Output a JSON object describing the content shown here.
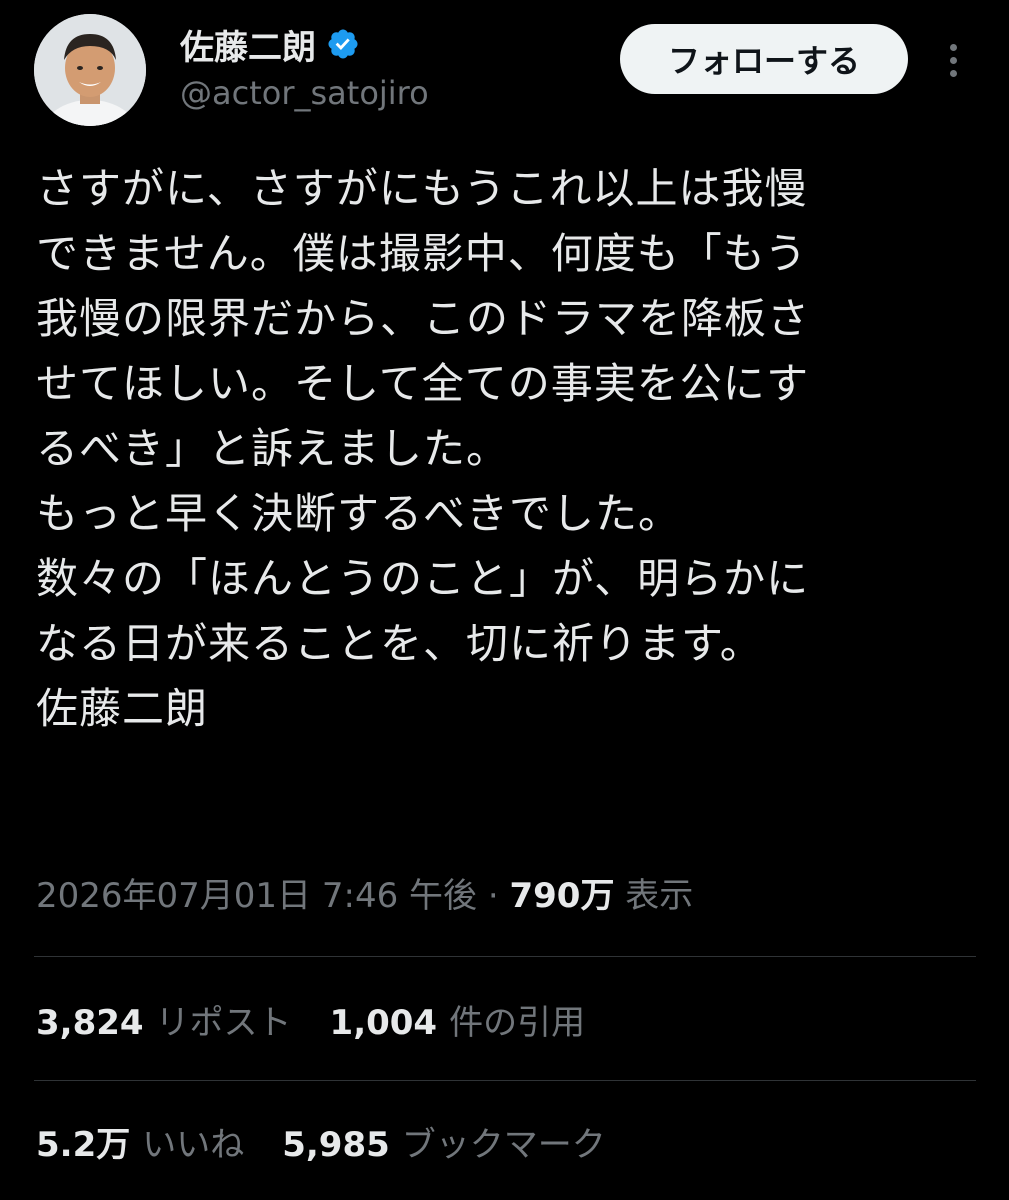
{
  "author": {
    "display_name": "佐藤二朗",
    "handle": "@actor_satojiro",
    "verified_color": "#1d9bf0"
  },
  "follow_button": {
    "label": "フォローする"
  },
  "more_icon": "more-vertical-icon",
  "tweet": {
    "lines": [
      "さすがに、さすがにもうこれ以上は我慢",
      "できません。僕は撮影中、何度も「もう",
      "我慢の限界だから、このドラマを降板さ",
      "せてほしい。そして全ての事実を公にす",
      "るべき」と訴えました。",
      "もっと早く決断するべきでした。",
      "数々の「ほんとうのこと」が、明らかに",
      "なる日が来ることを、切に祈ります。",
      "佐藤二朗"
    ]
  },
  "meta": {
    "timestamp": "2026年07月01日 7:46 午後",
    "separator": " · ",
    "views_count": "790万",
    "views_label": " 表示"
  },
  "stats": {
    "reposts": {
      "count": "3,824",
      "label": "リポスト"
    },
    "quotes": {
      "count": "1,004",
      "label": "件の引用"
    },
    "likes": {
      "count": "5.2万",
      "label": "いいね"
    },
    "bookmarks": {
      "count": "5,985",
      "label": "ブックマーク"
    }
  },
  "colors": {
    "background": "#000000",
    "text_primary": "#e7e9ea",
    "text_secondary": "#71767b",
    "divider": "#2f3336",
    "follow_bg": "#eff3f4"
  }
}
